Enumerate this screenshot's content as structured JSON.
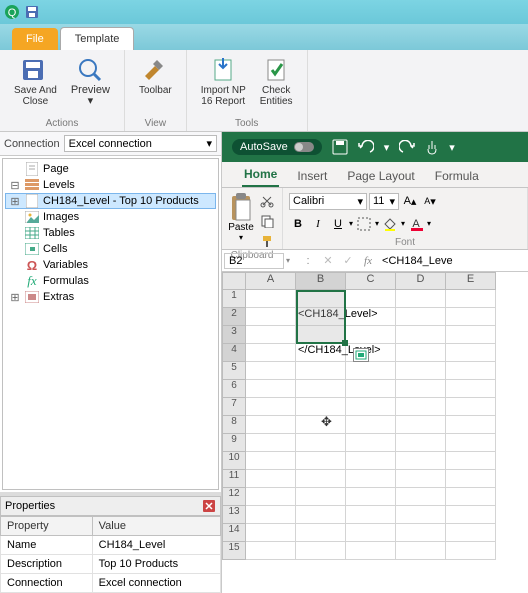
{
  "titlebar": {
    "app_icon": "Q"
  },
  "tabs": {
    "file": "File",
    "template": "Template"
  },
  "ribbon": {
    "save_close": "Save And\nClose",
    "preview": "Preview",
    "toolbar": "Toolbar",
    "import": "Import NP\n16 Report",
    "check": "Check\nEntities",
    "grp_actions": "Actions",
    "grp_view": "View",
    "grp_tools": "Tools"
  },
  "connection": {
    "label": "Connection",
    "value": "Excel connection"
  },
  "tree": {
    "page": "Page",
    "levels": "Levels",
    "level_item": "CH184_Level - Top 10 Products",
    "images": "Images",
    "tables": "Tables",
    "cells": "Cells",
    "variables": "Variables",
    "formulas": "Formulas",
    "extras": "Extras"
  },
  "properties": {
    "title": "Properties",
    "col_prop": "Property",
    "col_val": "Value",
    "rows": [
      {
        "p": "Name",
        "v": "CH184_Level"
      },
      {
        "p": "Description",
        "v": "Top 10 Products"
      },
      {
        "p": "Connection",
        "v": "Excel connection"
      }
    ]
  },
  "excel": {
    "autosave": "AutoSave",
    "tabs": {
      "home": "Home",
      "insert": "Insert",
      "page_layout": "Page Layout",
      "formulas": "Formula"
    },
    "paste": "Paste",
    "clipboard": "Clipboard",
    "font_name": "Calibri",
    "font_size": "11",
    "font_grp": "Font",
    "name_box": "B2",
    "fx_value": "<CH184_Leve",
    "cols": [
      "A",
      "B",
      "C",
      "D",
      "E"
    ],
    "rows": 15,
    "cell_b2": "<CH184_Level>",
    "cell_b4": "</CH184_Level>"
  }
}
